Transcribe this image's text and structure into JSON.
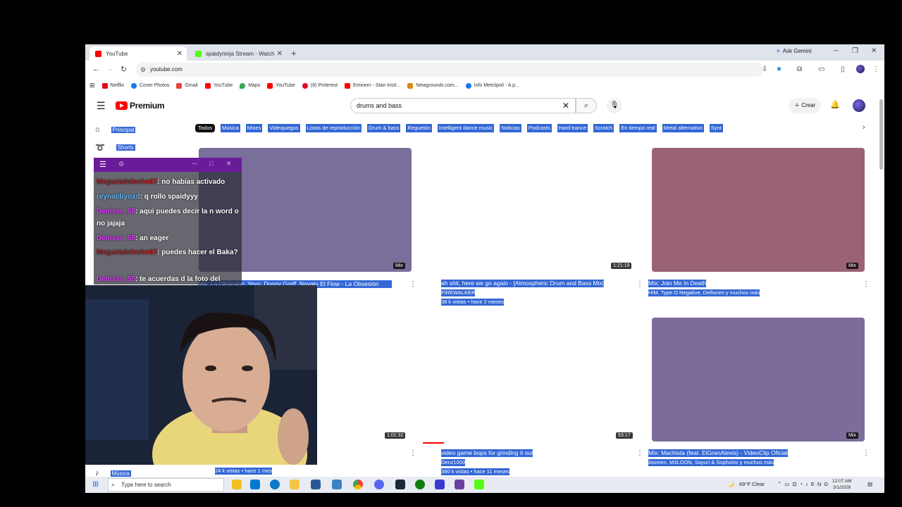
{
  "browser": {
    "tabs": [
      {
        "label": "YouTube",
        "active": true
      },
      {
        "label": "spaidyninja Stream - Watch Live",
        "active": false
      }
    ],
    "ask_gemini": "Ask Gemini",
    "url": "youtube.com",
    "bookmarks": [
      "Netflix",
      "Cover Photos",
      "Gmail",
      "YouTube",
      "Maps",
      "YouTube",
      "(8) Pinterest",
      "Eminem - Stan Instr...",
      "Newgrounds.com...",
      "Info Metrópoli - A p..."
    ]
  },
  "youtube": {
    "logo_text": "Premium",
    "search_value": "drums and bass",
    "create_label": "Crear",
    "chips": [
      "Todos",
      "Música",
      "Mixes",
      "Videojuegos",
      "Listas de reproducción",
      "Drum & bass",
      "Reguetón",
      "Intelligent dance music",
      "Noticias",
      "Podcasts",
      "Hard trance",
      "Scratch",
      "En tiempo real",
      "Metal alternativo",
      "Synt"
    ],
    "sidebar": {
      "home": "Principal",
      "shorts": "Shorts",
      "music": "Música"
    },
    "videos": [
      {
        "title": "Mix: La Obsesión, Yeyo, Doony Graff, Novato El Flow - La Obsesión",
        "badge": "Mix",
        "color": "#7a6e9a"
      },
      {
        "title": "ah shit, here we go again - [Atmospheric Drum and Bass Mix]",
        "channel": "FIREWALKER",
        "meta": "38 k vistas • hace 2 meses",
        "badge": "1:21:19"
      },
      {
        "title": "Mix: Join Me In Death",
        "channel": "HIM, Type O Negative, Deftones y muchos más",
        "badge": "Mix",
        "color": "#9a6276"
      },
      {
        "title": "",
        "meta": "24 k vistas • hace 1 mes",
        "badge": "1:01:32"
      },
      {
        "title": "video game bops for grinding it out",
        "channel": "Denz1000",
        "meta": "390 k vistas • hace 11 meses",
        "badge": "53:17"
      },
      {
        "title": "Mix: Machista (feat. ElGranAlexis) - VideoClip Oficial",
        "channel": "Atomen, M3LOON, Sayuri & Sopholov y muchos más",
        "badge": "Mix",
        "color": "#7c6c9c"
      }
    ]
  },
  "chat": {
    "messages": [
      {
        "user": "Meguztalnlecho67",
        "text": ": no habias activado"
      },
      {
        "user": "reynaldiyoxd",
        "text": ": q rollo spaidyyy"
      },
      {
        "user": "Denisss_55",
        "text": ": aqui puedes decir la n word o no jajaja"
      },
      {
        "user": "Denisss_55",
        "text": ": an eager"
      },
      {
        "user": "Meguztalnlecho67",
        "text": ": puedes hacer el Baka?"
      },
      {
        "user": "Denisss_55",
        "text": ": te acuerdas d la foto del"
      }
    ]
  },
  "taskbar": {
    "search_placeholder": "Type here to search",
    "weather": "69°F  Clear",
    "time": "12:07 AM",
    "date": "3/1/2026"
  }
}
